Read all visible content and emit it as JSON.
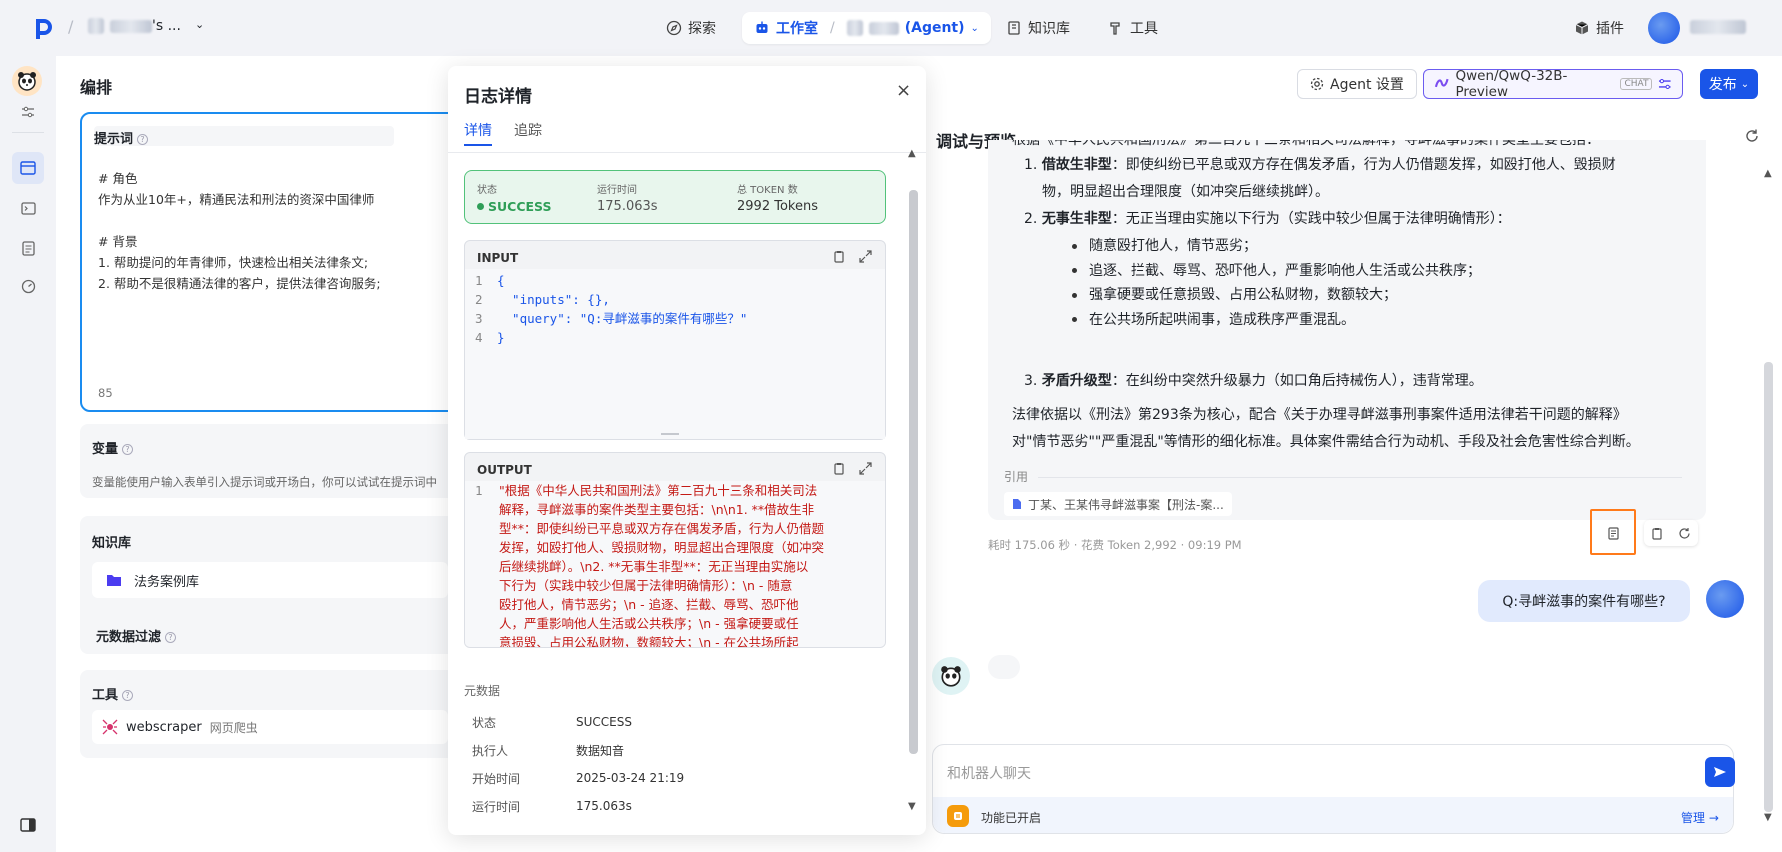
{
  "topbar": {
    "workspace_suffix": "'s ...",
    "nav_explore": "探索",
    "nav_studio": "工作室",
    "nav_agent_suffix": "(Agent)",
    "nav_knowledge": "知识库",
    "nav_tools": "工具",
    "nav_plugins": "插件"
  },
  "editor": {
    "title": "编排",
    "prompt_label": "提示词",
    "prompt_lines": [
      "# 角色",
      "作为从业10年+，精通民法和刑法的资深中国律师",
      "",
      "# 背景",
      "1. 帮助提问的年青律师，快速检出相关法律条文;",
      "2. 帮助不是很精通法律的客户，提供法律咨询服务;"
    ],
    "prompt_count": "85",
    "variables_label": "变量",
    "variables_desc": "变量能使用户输入表单引入提示词或开场白，你可以试试在提示词中",
    "kb_label": "知识库",
    "kb_item": "法务案例库",
    "metadata_filter": "元数据过滤",
    "tools_label": "工具",
    "tool_name": "webscraper",
    "tool_desc": "网页爬虫"
  },
  "modal": {
    "title": "日志详情",
    "tab_detail": "详情",
    "tab_trace": "追踪",
    "status_label": "状态",
    "status_value": "SUCCESS",
    "runtime_label": "运行时间",
    "runtime_value": "175.063s",
    "tokens_label": "总 TOKEN 数",
    "tokens_value": "2992 Tokens",
    "input_label": "INPUT",
    "input_lines": [
      {
        "n": "1",
        "t": "{"
      },
      {
        "n": "2",
        "t": "  \"inputs\": {},"
      },
      {
        "n": "3",
        "t": "  \"query\": \"Q:寻衅滋事的案件有哪些？\""
      },
      {
        "n": "4",
        "t": "}"
      }
    ],
    "output_label": "OUTPUT",
    "output_ln": "1",
    "output_lines": [
      "\"根据《中华人民共和国刑法》第二百九十三条和相关司法",
      "解释，寻衅滋事的案件类型主要包括：\\n\\n1. **借故生非",
      "型**：即使纠纷已平息或双方存在偶发矛盾，行为人仍借题",
      "发挥，如殴打他人、毁损财物，明显超出合理限度（如冲突",
      "后继续挑衅）。\\n2. **无事生非型**：无正当理由实施以",
      "下行为（实践中较少但属于法律明确情形）：\\n   - 随意",
      "殴打他人，情节恶劣；\\n   - 追逐、拦截、辱骂、恐吓他",
      "人，严重影响他人生活或公共秩序；\\n   - 强拿硬要或任",
      "意损毁、占用公私财物，数额较大；\\n   - 在公共场所起"
    ],
    "meta_title": "元数据",
    "meta": [
      {
        "k": "状态",
        "v": "SUCCESS"
      },
      {
        "k": "执行人",
        "v": "数据知音"
      },
      {
        "k": "开始时间",
        "v": "2025-03-24 21:19"
      },
      {
        "k": "运行时间",
        "v": "175.063s"
      }
    ]
  },
  "preview": {
    "agent_settings": "Agent 设置",
    "model_name": "Qwen/QwQ-32B-Preview",
    "model_tag": "CHAT",
    "publish": "发布",
    "title": "调试与预览",
    "cut_line": "根据《中华人民共和国刑法》第二百九十三条和相关司法解释，寻衅滋事的案件类型主要包括：",
    "item1_bold": "借故生非型",
    "item1_text": "：即使纠纷已平息或双方存在偶发矛盾，行为人仍借题发挥，如殴打他人、毁损财",
    "item1_text2": "物，明显超出合理限度（如冲突后继续挑衅）。",
    "item2_bold": "无事生非型",
    "item2_text": "：无正当理由实施以下行为（实践中较少但属于法律明确情形）：",
    "bullets": [
      "随意殴打他人，情节恶劣；",
      "追逐、拦截、辱骂、恐吓他人，严重影响他人生活或公共秩序；",
      "强拿硬要或任意损毁、占用公私财物，数额较大；",
      "在公共场所起哄闹事，造成秩序严重混乱。"
    ],
    "item3_bold": "矛盾升级型",
    "item3_text": "：在纠纷中突然升级暴力（如口角后持械伤人），违背常理。",
    "basis1": "法律依据以《刑法》第293条为核心，配合《关于办理寻衅滋事刑事案件适用法律若干问题的解释》",
    "basis2": "对\"情节恶劣\"\"严重混乱\"等情形的细化标准。具体案件需结合行为动机、手段及社会危害性综合判断。",
    "citation_label": "引用",
    "citation_item": "丁某、王某伟寻衅滋事案【刑法-案...",
    "meta_line": "耗时 175.06 秒 · 花费 Token 2,992 · 09:19 PM",
    "user_question": "Q:寻衅滋事的案件有哪些?",
    "input_placeholder": "和机器人聊天",
    "feature_status": "功能已开启",
    "manage": "管理"
  },
  "colors": {
    "accent": "#1a55e8",
    "success": "#2f9e57",
    "highlight": "#ff7a1a",
    "code_red": "#c41a16"
  }
}
